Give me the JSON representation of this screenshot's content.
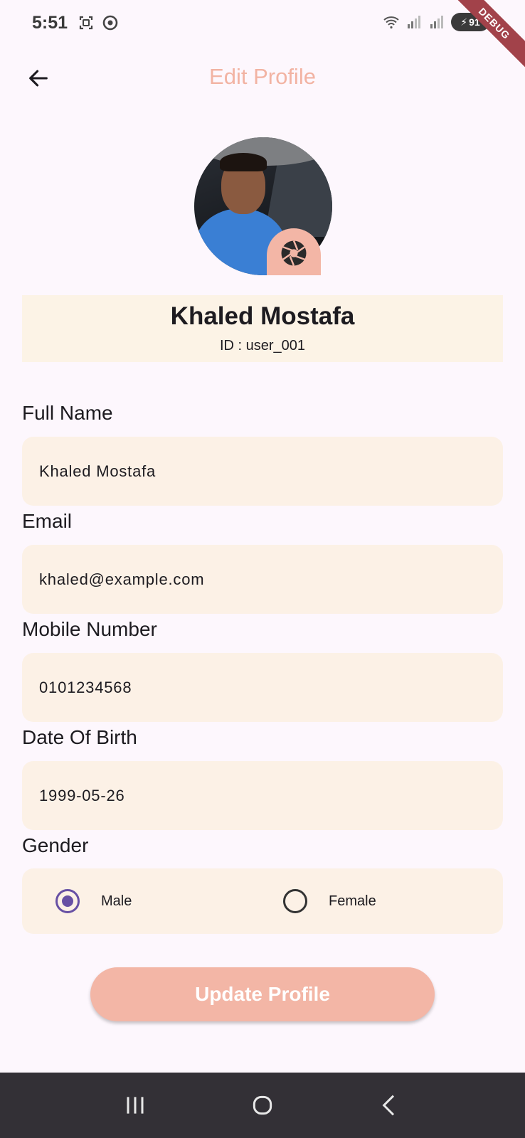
{
  "status_bar": {
    "time": "5:51",
    "battery_level": "91",
    "left_icons": [
      "screenshot-icon",
      "chrome-icon"
    ],
    "right_icons": [
      "wifi-icon",
      "signal-icon",
      "signal-icon",
      "battery-icon"
    ]
  },
  "debug_banner": "DEBUG",
  "app_bar": {
    "title": "Edit Profile",
    "back_icon": "arrow-back-icon"
  },
  "profile": {
    "name": "Khaled Mostafa",
    "id_text": "ID : user_001",
    "camera_icon": "camera-aperture-icon"
  },
  "form": {
    "full_name": {
      "label": "Full Name",
      "value": "Khaled Mostafa"
    },
    "email": {
      "label": "Email",
      "value": "khaled@example.com"
    },
    "mobile": {
      "label": "Mobile Number",
      "value": "0101234568"
    },
    "dob": {
      "label": "Date Of Birth",
      "value": "1999-05-26"
    },
    "gender": {
      "label": "Gender",
      "options": [
        "Male",
        "Female"
      ],
      "selected": "Male"
    }
  },
  "update_button": "Update Profile",
  "colors": {
    "accent": "#f3b6a6",
    "title": "#f2b3a3",
    "field_bg": "#fcf1e6",
    "radio_selected": "#6750a4",
    "background": "#fdf7fd",
    "nav_bar": "#333036"
  },
  "nav": [
    "recent-apps-icon",
    "home-icon",
    "back-icon"
  ]
}
